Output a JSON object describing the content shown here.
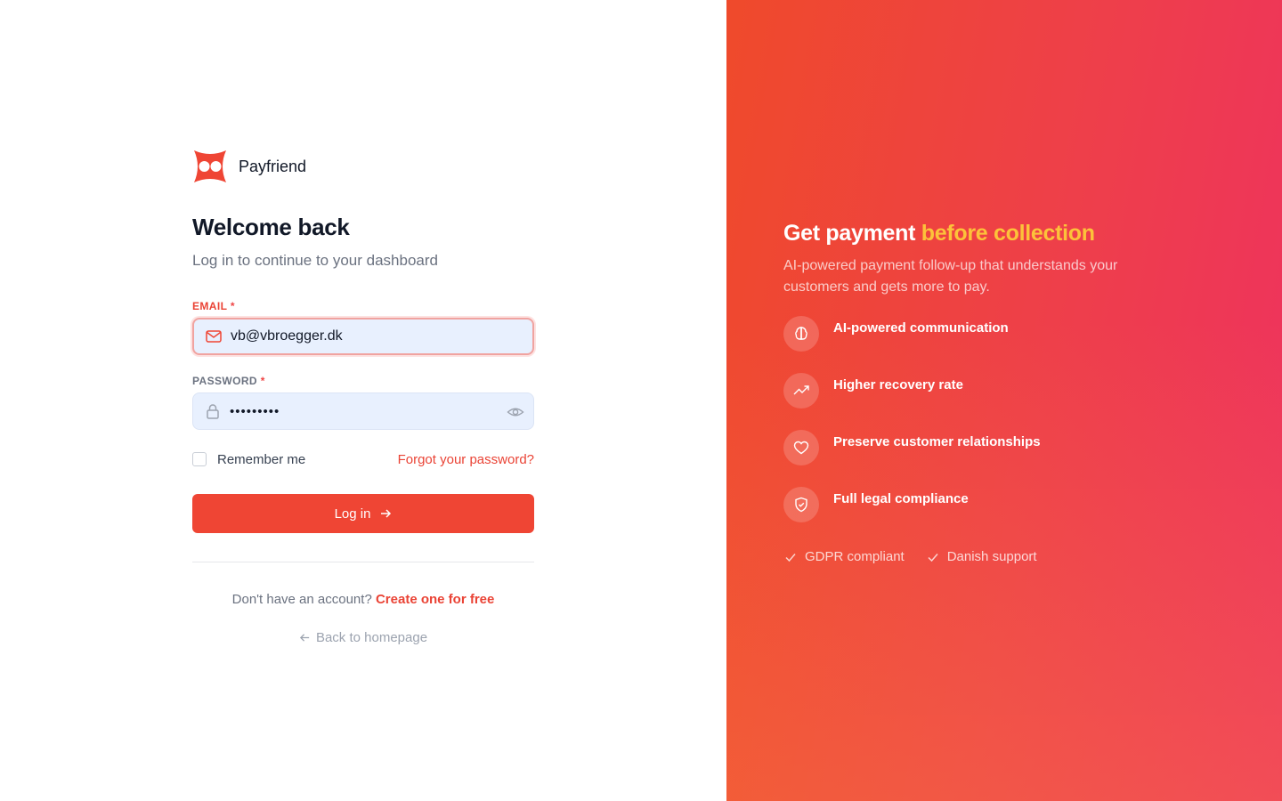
{
  "brand": {
    "name": "Payfriend"
  },
  "login": {
    "title": "Welcome back",
    "subtitle": "Log in to continue to your dashboard",
    "email": {
      "label": "EMAIL",
      "required_mark": "*",
      "value": "vb@vbroegger.dk"
    },
    "password": {
      "label": "PASSWORD",
      "required_mark": "*",
      "value": "•••••••••"
    },
    "remember_label": "Remember me",
    "forgot_label": "Forgot your password?",
    "submit_label": "Log in",
    "signup_prompt": "Don't have an account?",
    "signup_link": "Create one for free",
    "back_label": "Back to homepage"
  },
  "promo": {
    "headline_main": "Get payment",
    "headline_highlight": "before collection",
    "description": "AI-powered payment follow-up that understands your customers and gets more to pay.",
    "features": [
      {
        "label": "AI-powered communication",
        "icon": "brain-icon"
      },
      {
        "label": "Higher recovery rate",
        "icon": "trending-up-icon"
      },
      {
        "label": "Preserve customer relationships",
        "icon": "heart-icon"
      },
      {
        "label": "Full legal compliance",
        "icon": "shield-check-icon"
      }
    ],
    "badges": [
      "GDPR compliant",
      "Danish support"
    ]
  },
  "colors": {
    "accent": "#ef4534",
    "highlight": "#fcc23a",
    "gradient_start": "#ef4a2b",
    "gradient_end": "#ee3160"
  }
}
